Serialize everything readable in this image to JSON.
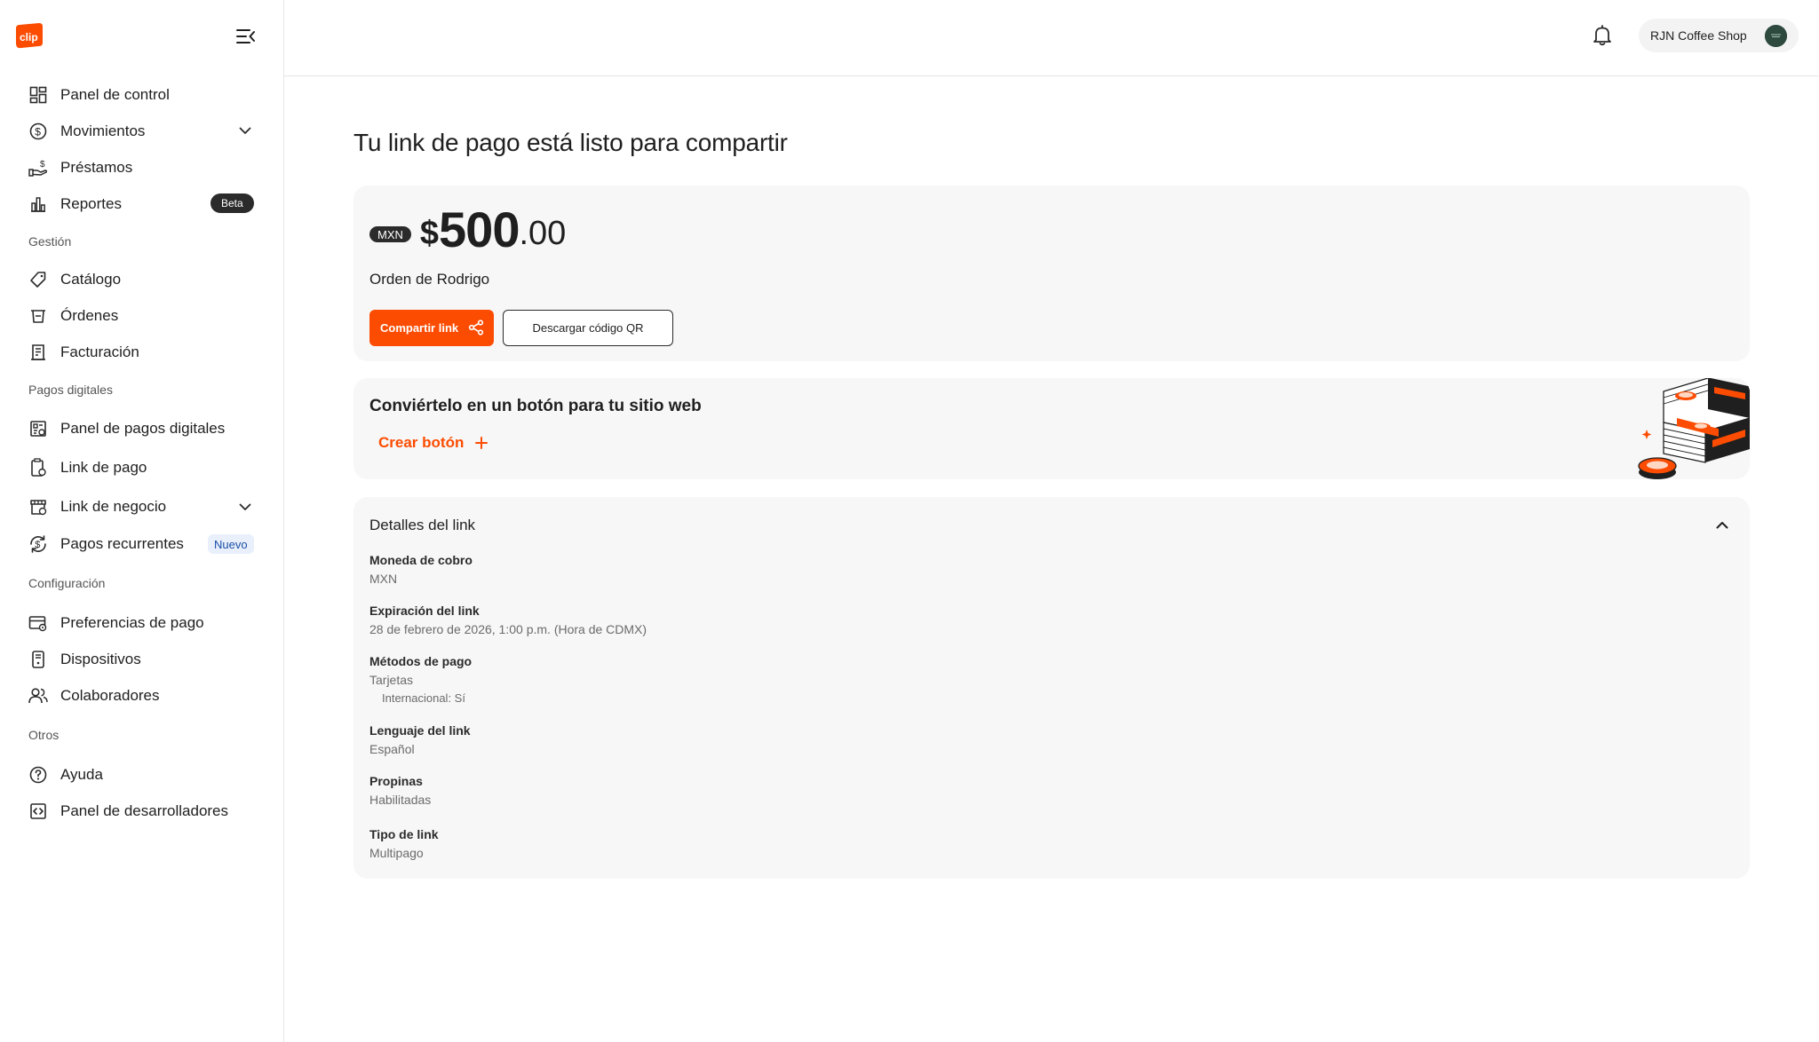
{
  "brand": {
    "logo_text": "clip",
    "accent": "#FC4C02"
  },
  "sidebar": {
    "group1": [
      {
        "label": "Panel de control",
        "icon": "dashboard-icon"
      },
      {
        "label": "Movimientos",
        "icon": "dollar-circle-icon",
        "expandable": true
      },
      {
        "label": "Préstamos",
        "icon": "loan-hand-icon"
      },
      {
        "label": "Reportes",
        "icon": "bar-chart-icon",
        "badge": "Beta"
      }
    ],
    "section_gestion": "Gestión",
    "gestion": [
      {
        "label": "Catálogo",
        "icon": "tag-icon"
      },
      {
        "label": "Órdenes",
        "icon": "basket-icon"
      },
      {
        "label": "Facturación",
        "icon": "invoice-icon"
      }
    ],
    "section_pagos": "Pagos digitales",
    "pagos": [
      {
        "label": "Panel de pagos digitales",
        "icon": "digital-payments-icon"
      },
      {
        "label": "Link de pago",
        "icon": "payment-link-icon"
      },
      {
        "label": "Link de negocio",
        "icon": "store-link-icon",
        "expandable": true
      },
      {
        "label": "Pagos recurrentes",
        "icon": "recurring-dollar-icon",
        "badge": "Nuevo"
      }
    ],
    "section_config": "Configuración",
    "config": [
      {
        "label": "Preferencias de pago",
        "icon": "card-settings-icon"
      },
      {
        "label": "Dispositivos",
        "icon": "device-icon"
      },
      {
        "label": "Colaboradores",
        "icon": "users-icon"
      }
    ],
    "section_otros": "Otros",
    "otros": [
      {
        "label": "Ayuda",
        "icon": "help-icon"
      },
      {
        "label": "Panel de desarrolladores",
        "icon": "code-icon"
      }
    ]
  },
  "header": {
    "account_name": "RJN Coffee Shop"
  },
  "main": {
    "title": "Tu link de pago está listo para compartir",
    "amount": {
      "currency": "MXN",
      "sign": "$",
      "integer": "500",
      "decimal": ".00"
    },
    "order_name": "Orden de Rodrigo",
    "share_button": "Compartir link",
    "qr_button": "Descargar código QR",
    "web_button_card": {
      "title": "Conviértelo en un botón para tu sitio web",
      "action": "Crear botón"
    },
    "details": {
      "title": "Detalles del link",
      "fields": [
        {
          "label": "Moneda de cobro",
          "value": "MXN"
        },
        {
          "label": "Expiración del link",
          "value": "28 de febrero de 2026, 1:00 p.m. (Hora de CDMX)"
        },
        {
          "label": "Métodos de pago",
          "value": "Tarjetas",
          "sub": "Internacional: Sí"
        },
        {
          "label": "Lenguaje del link",
          "value": "Español"
        },
        {
          "label": "Propinas",
          "value": "Habilitadas"
        },
        {
          "label": "Tipo de link",
          "value": "Multipago"
        }
      ]
    }
  }
}
